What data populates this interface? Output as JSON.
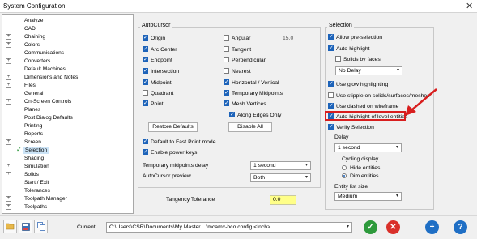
{
  "window": {
    "title": "System Configuration",
    "close": "✕"
  },
  "tree": {
    "items": [
      {
        "label": "Analyze",
        "expandable": false
      },
      {
        "label": "CAD",
        "expandable": false
      },
      {
        "label": "Chaining",
        "expandable": true
      },
      {
        "label": "Colors",
        "expandable": true
      },
      {
        "label": "Communications",
        "expandable": false
      },
      {
        "label": "Converters",
        "expandable": true
      },
      {
        "label": "Default Machines",
        "expandable": false
      },
      {
        "label": "Dimensions and Notes",
        "expandable": true
      },
      {
        "label": "Files",
        "expandable": true
      },
      {
        "label": "General",
        "expandable": false
      },
      {
        "label": "On-Screen Controls",
        "expandable": true
      },
      {
        "label": "Planes",
        "expandable": false
      },
      {
        "label": "Post Dialog Defaults",
        "expandable": false
      },
      {
        "label": "Printing",
        "expandable": false
      },
      {
        "label": "Reports",
        "expandable": false
      },
      {
        "label": "Screen",
        "expandable": true
      },
      {
        "label": "Selection",
        "expandable": false,
        "selected": true,
        "checked": true
      },
      {
        "label": "Shading",
        "expandable": false
      },
      {
        "label": "Simulation",
        "expandable": true
      },
      {
        "label": "Solids",
        "expandable": true
      },
      {
        "label": "Start / Exit",
        "expandable": false
      },
      {
        "label": "Tolerances",
        "expandable": false
      },
      {
        "label": "Toolpath Manager",
        "expandable": true
      },
      {
        "label": "Toolpaths",
        "expandable": true
      }
    ],
    "check_glyph": "✓",
    "plus_glyph": "+"
  },
  "autocursor": {
    "group_label": "AutoCursor",
    "origin": "Origin",
    "arc_center": "Arc Center",
    "endpoint": "Endpoint",
    "intersection": "Intersection",
    "midpoint": "Midpoint",
    "quadrant": "Quadrant",
    "point": "Point",
    "angular": "Angular",
    "angular_value": "15.0",
    "tangent": "Tangent",
    "perpendicular": "Perpendicular",
    "nearest": "Nearest",
    "horizontal_vertical": "Horizontal / Vertical",
    "temporary_midpoints": "Temporary Midpoints",
    "mesh_vertices": "Mesh Vertices",
    "along_edges_only": "Along Edges Only",
    "restore_defaults": "Restore Defaults",
    "disable_all": "Disable All",
    "default_fast_point": "Default to Fast Point mode",
    "enable_power_keys": "Enable power keys",
    "temp_midpoints_delay_label": "Temporary midpoints delay",
    "temp_midpoints_delay_value": "1 second",
    "preview_label": "AutoCursor preview",
    "preview_value": "Both"
  },
  "tangency": {
    "label": "Tangency Tolerance",
    "value": "0.0"
  },
  "selection": {
    "group_label": "Selection",
    "allow_preselection": "Allow pre-selection",
    "auto_highlight": "Auto-highlight",
    "solids_by_faces": "Solids by faces",
    "delay_dropdown": "No Delay",
    "use_glow": "Use glow highlighting",
    "use_stipple": "Use stipple on solids/surfaces/meshes",
    "use_dashed": "Use dashed on wireframe",
    "auto_highlight_level": "Auto-highlight of level entities",
    "verify_selection": "Verify Selection",
    "delay_label": "Delay",
    "delay_value": "1 second",
    "cycling_label": "Cycling display",
    "hide_entities": "Hide entities",
    "dim_entities": "Dim entities",
    "entity_list_label": "Entity list size",
    "entity_list_value": "Medium"
  },
  "bottom": {
    "current_label": "Current:",
    "current_value": "C:\\Users\\CSR\\Documents\\My Master…\\mcamx-bco.config <Inch>",
    "ok_glyph": "✓",
    "cancel_glyph": "✕",
    "add_glyph": "+",
    "help_glyph": "?",
    "dropdown_arrow": "▾"
  },
  "colors": {
    "accent": "#1d63b9",
    "highlight_box": "#d81e1e",
    "tangency_bg": "#ffff88",
    "ok": "#2e9a3c",
    "cancel": "#d9302a",
    "add": "#1f6fc5",
    "help": "#1f6fc5"
  }
}
